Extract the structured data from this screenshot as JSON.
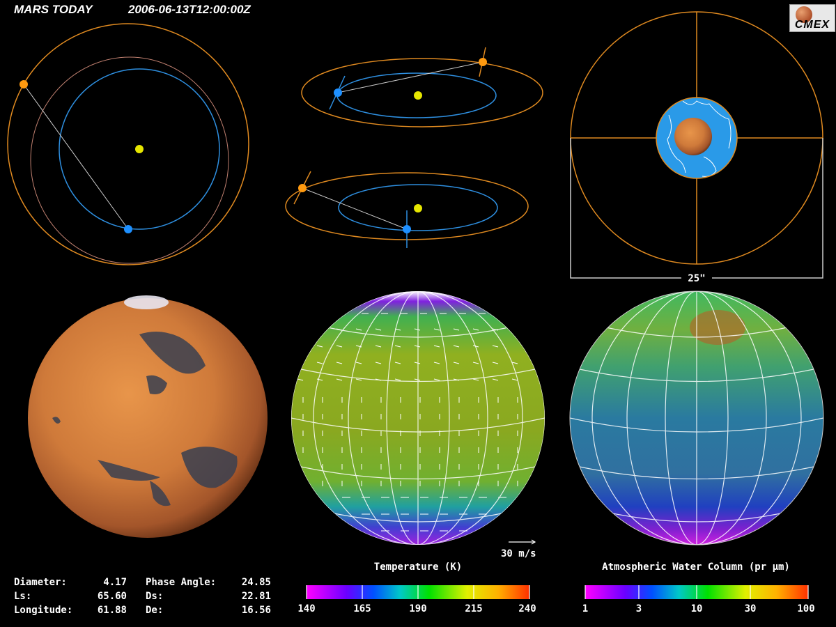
{
  "header": {
    "title": "MARS TODAY",
    "timestamp": "2006-06-13T12:00:00Z"
  },
  "logo": {
    "text": "CMEX"
  },
  "view": {
    "scale_label": "25\""
  },
  "wind": {
    "scale_label": "30 m/s"
  },
  "stats": {
    "diameter_label": "Diameter:",
    "diameter_value": "4.17",
    "ls_label": "Ls:",
    "ls_value": "65.60",
    "longitude_label": "Longitude:",
    "longitude_value": "61.88",
    "phase_label": "Phase Angle:",
    "phase_value": "24.85",
    "ds_label": "Ds:",
    "ds_value": "22.81",
    "de_label": "De:",
    "de_value": "16.56"
  },
  "temperature_scale": {
    "title": "Temperature (K)",
    "ticks": [
      "140",
      "165",
      "190",
      "215",
      "240"
    ]
  },
  "water_scale": {
    "title": "Atmospheric Water Column (pr µm)",
    "ticks": [
      "1",
      "3",
      "10",
      "30",
      "100"
    ]
  },
  "colors": {
    "mars_orbit": "#e08a20",
    "earth_orbit": "#2e8fe0",
    "sun": "#e6e600",
    "earth": "#1e90ff",
    "mars": "#ff9a10"
  }
}
